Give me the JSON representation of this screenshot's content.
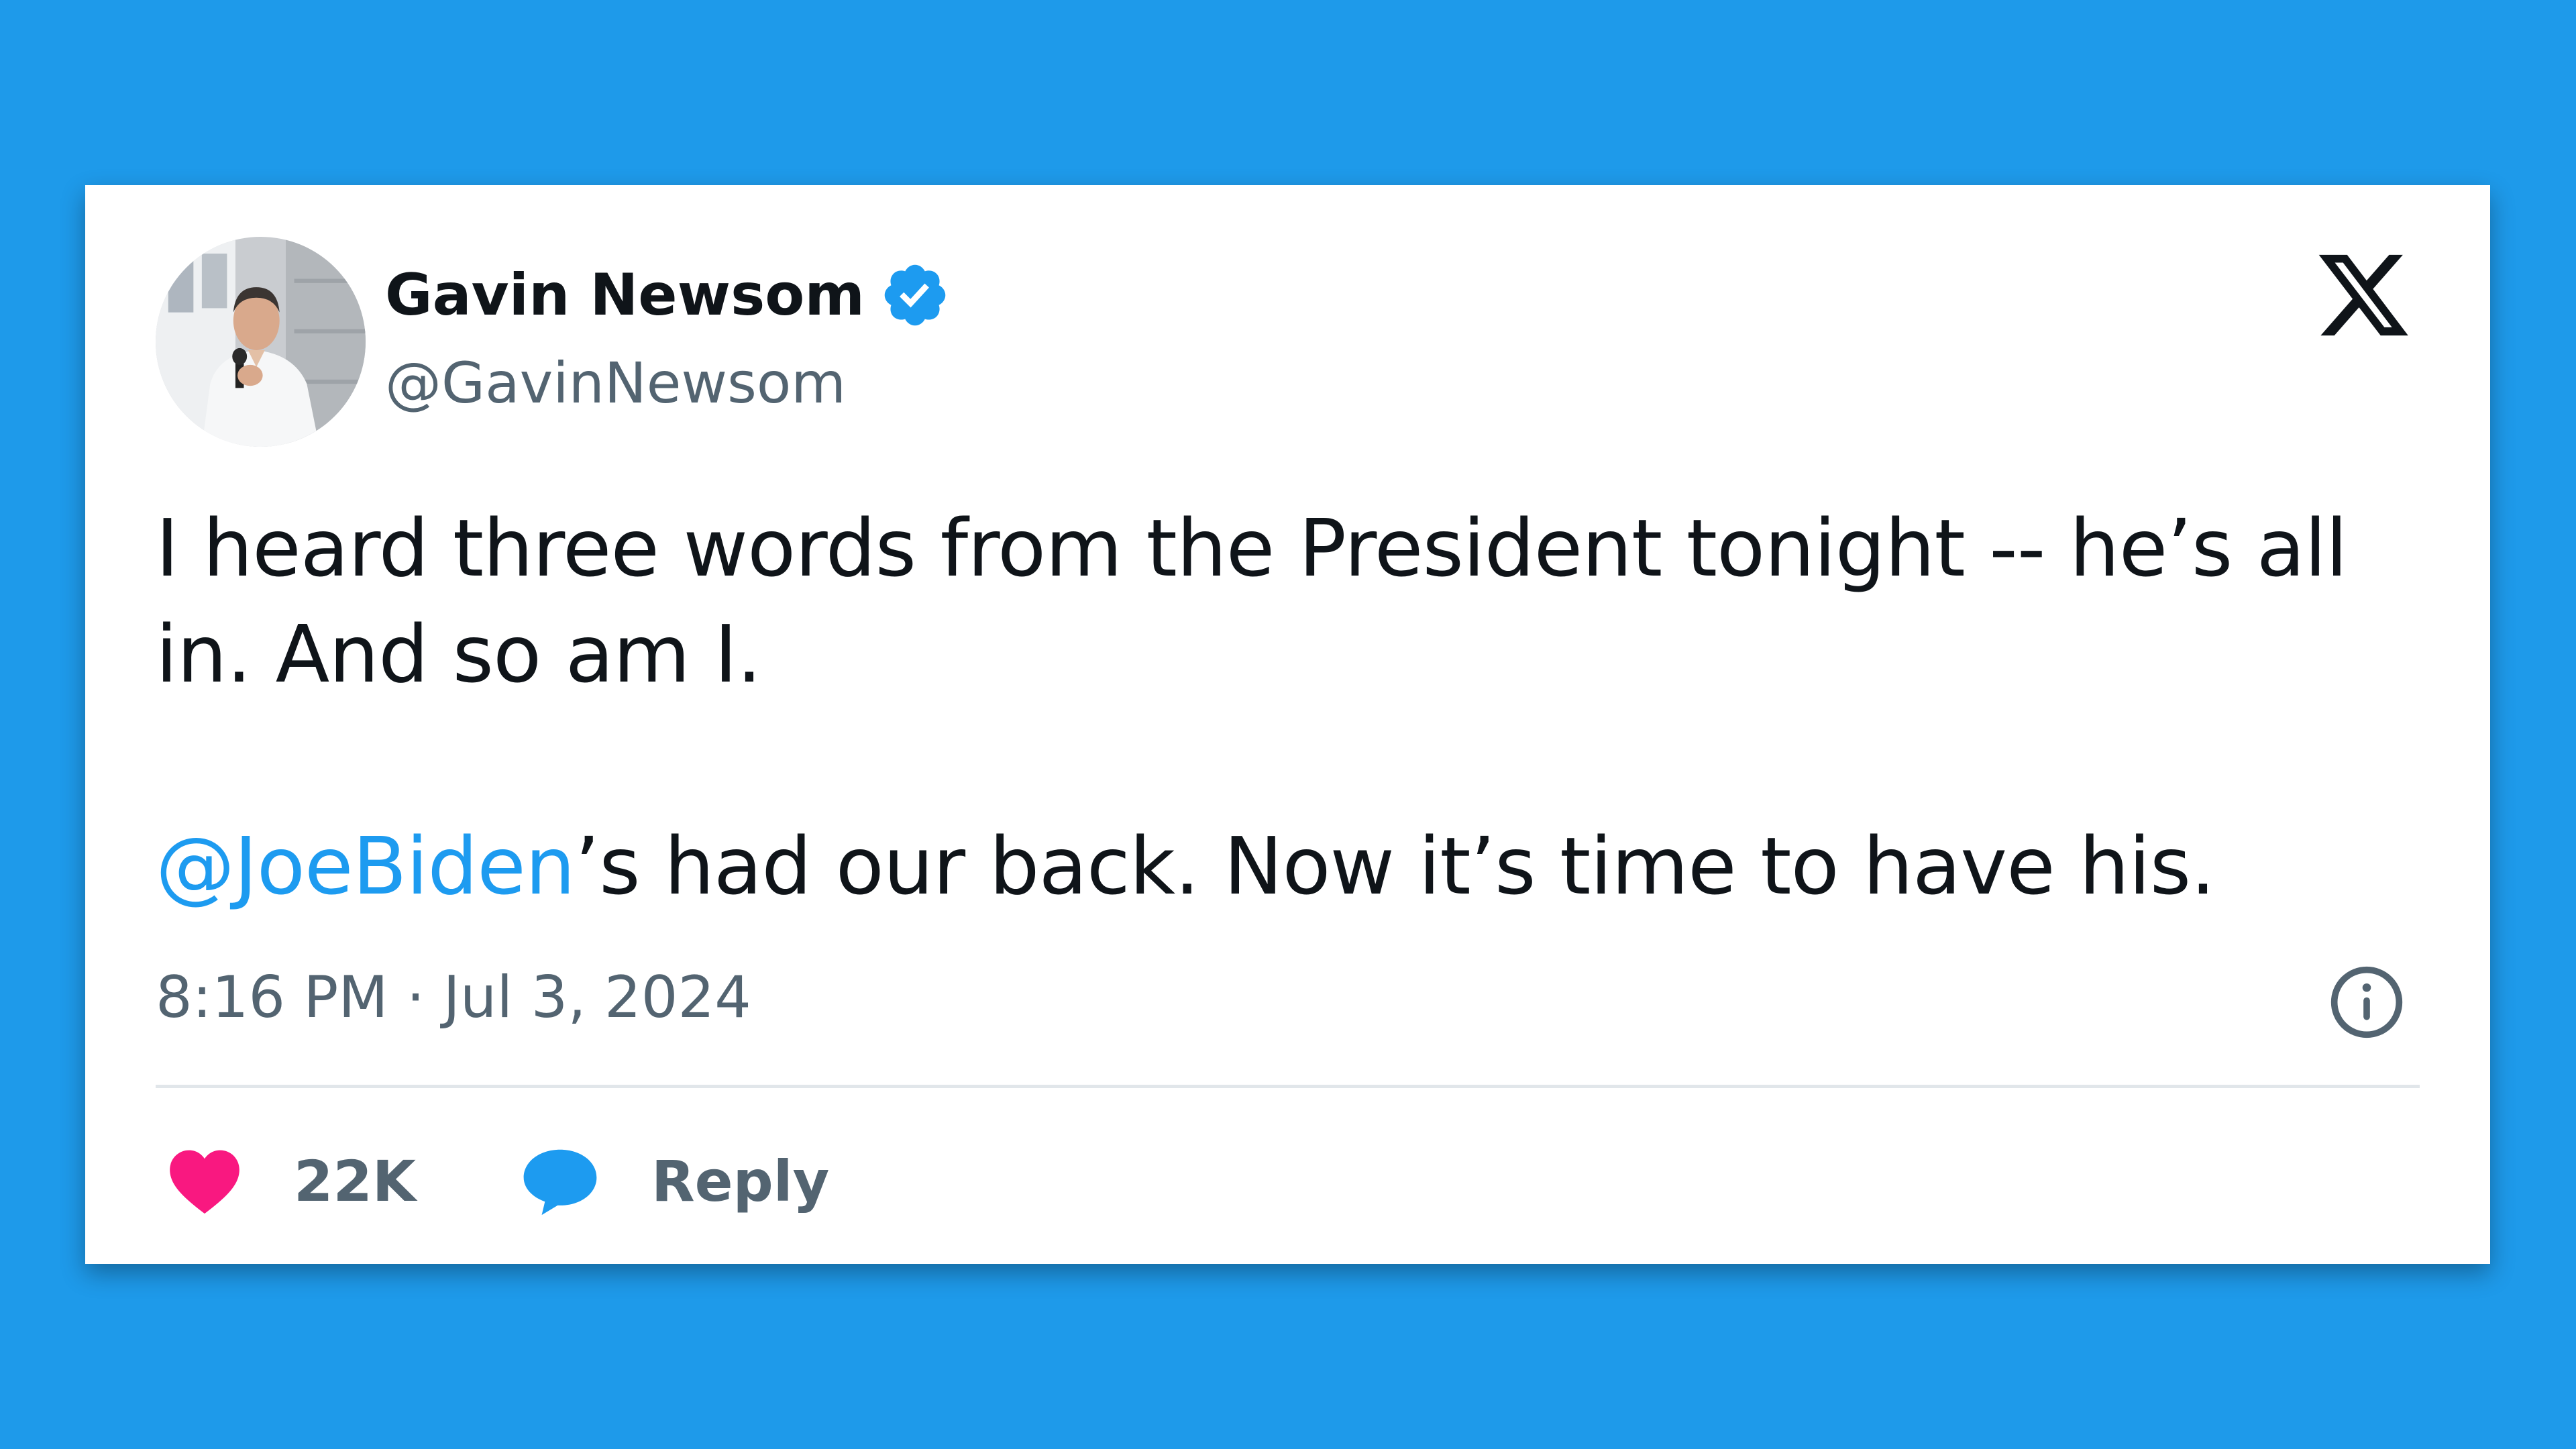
{
  "tweet": {
    "author": {
      "display_name": "Gavin Newsom",
      "handle": "@GavinNewsom",
      "verified": true
    },
    "text_line1": "I heard three words from the President tonight -- he’s all in. And so am I.",
    "mention": "@JoeBiden",
    "text_line2_rest": "’s had our back. Now it’s time to have his.",
    "timestamp": "8:16 PM · Jul 3, 2024",
    "likes": "22K",
    "reply_label": "Reply"
  },
  "icons": {
    "brand": "x-logo-icon",
    "verified": "verified-badge-icon",
    "info": "info-icon",
    "like": "heart-icon",
    "reply": "speech-bubble-icon"
  },
  "colors": {
    "background": "#1e9aea",
    "link": "#1d9bf0",
    "like": "#f91880",
    "text": "#0f1419",
    "secondary": "#536471"
  }
}
